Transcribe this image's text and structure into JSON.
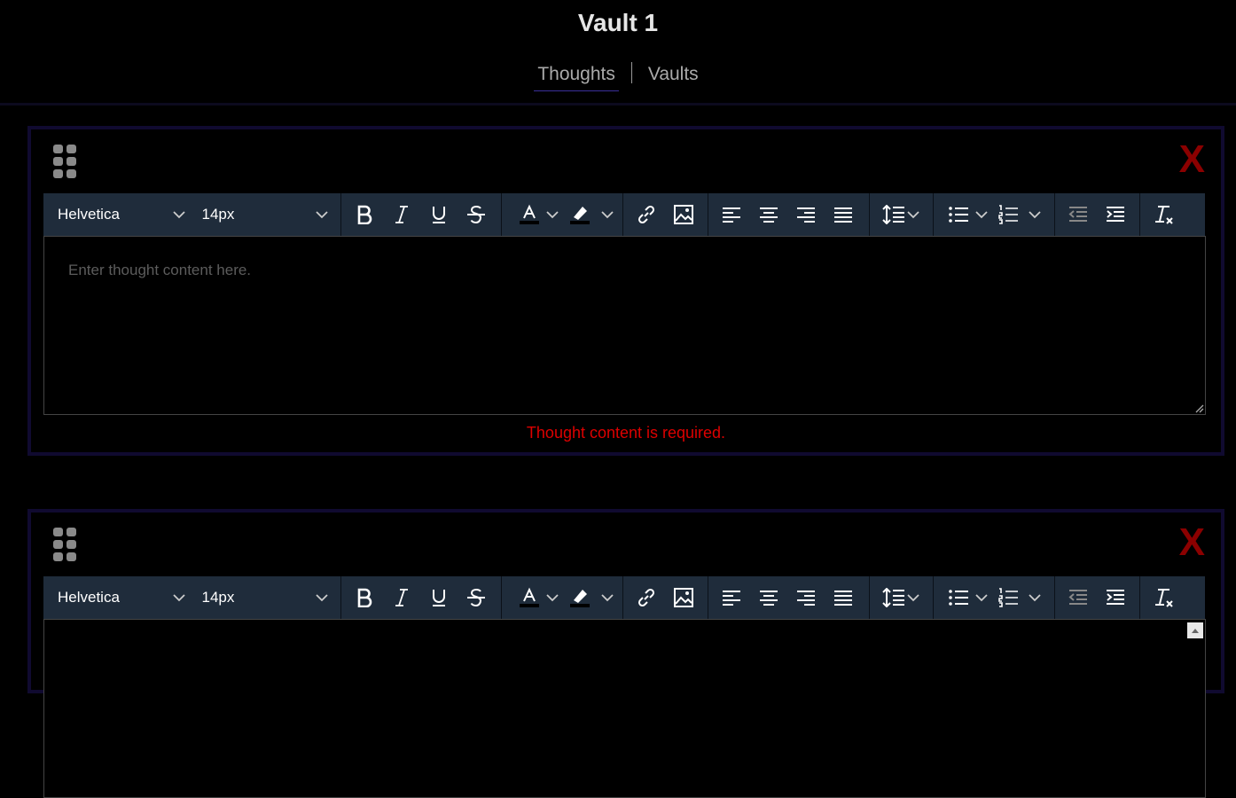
{
  "header": {
    "title": "Vault 1"
  },
  "nav": {
    "tabs": [
      {
        "label": "Thoughts",
        "active": true
      },
      {
        "label": "Vaults",
        "active": false
      }
    ]
  },
  "cards": [
    {
      "close_label": "X",
      "toolbar": {
        "font_family": "Helvetica",
        "font_size": "14px"
      },
      "editor": {
        "placeholder": "Enter thought content here."
      },
      "error": "Thought content is required."
    },
    {
      "close_label": "X",
      "toolbar": {
        "font_family": "Helvetica",
        "font_size": "14px"
      }
    }
  ],
  "colors": {
    "background": "#000000",
    "toolbar": "#1f2c3b",
    "close": "#8b0000",
    "error": "#dd0000",
    "card_border": "#100a30",
    "tab_underline": "#3a2f9a"
  },
  "icons": [
    "drag-handle-icon",
    "close-icon",
    "bold-icon",
    "italic-icon",
    "underline-icon",
    "strikethrough-icon",
    "font-color-icon",
    "highlight-icon",
    "link-icon",
    "image-icon",
    "align-left-icon",
    "align-center-icon",
    "align-right-icon",
    "align-justify-icon",
    "line-height-icon",
    "bullet-list-icon",
    "numbered-list-icon",
    "outdent-icon",
    "indent-icon",
    "clear-format-icon"
  ]
}
